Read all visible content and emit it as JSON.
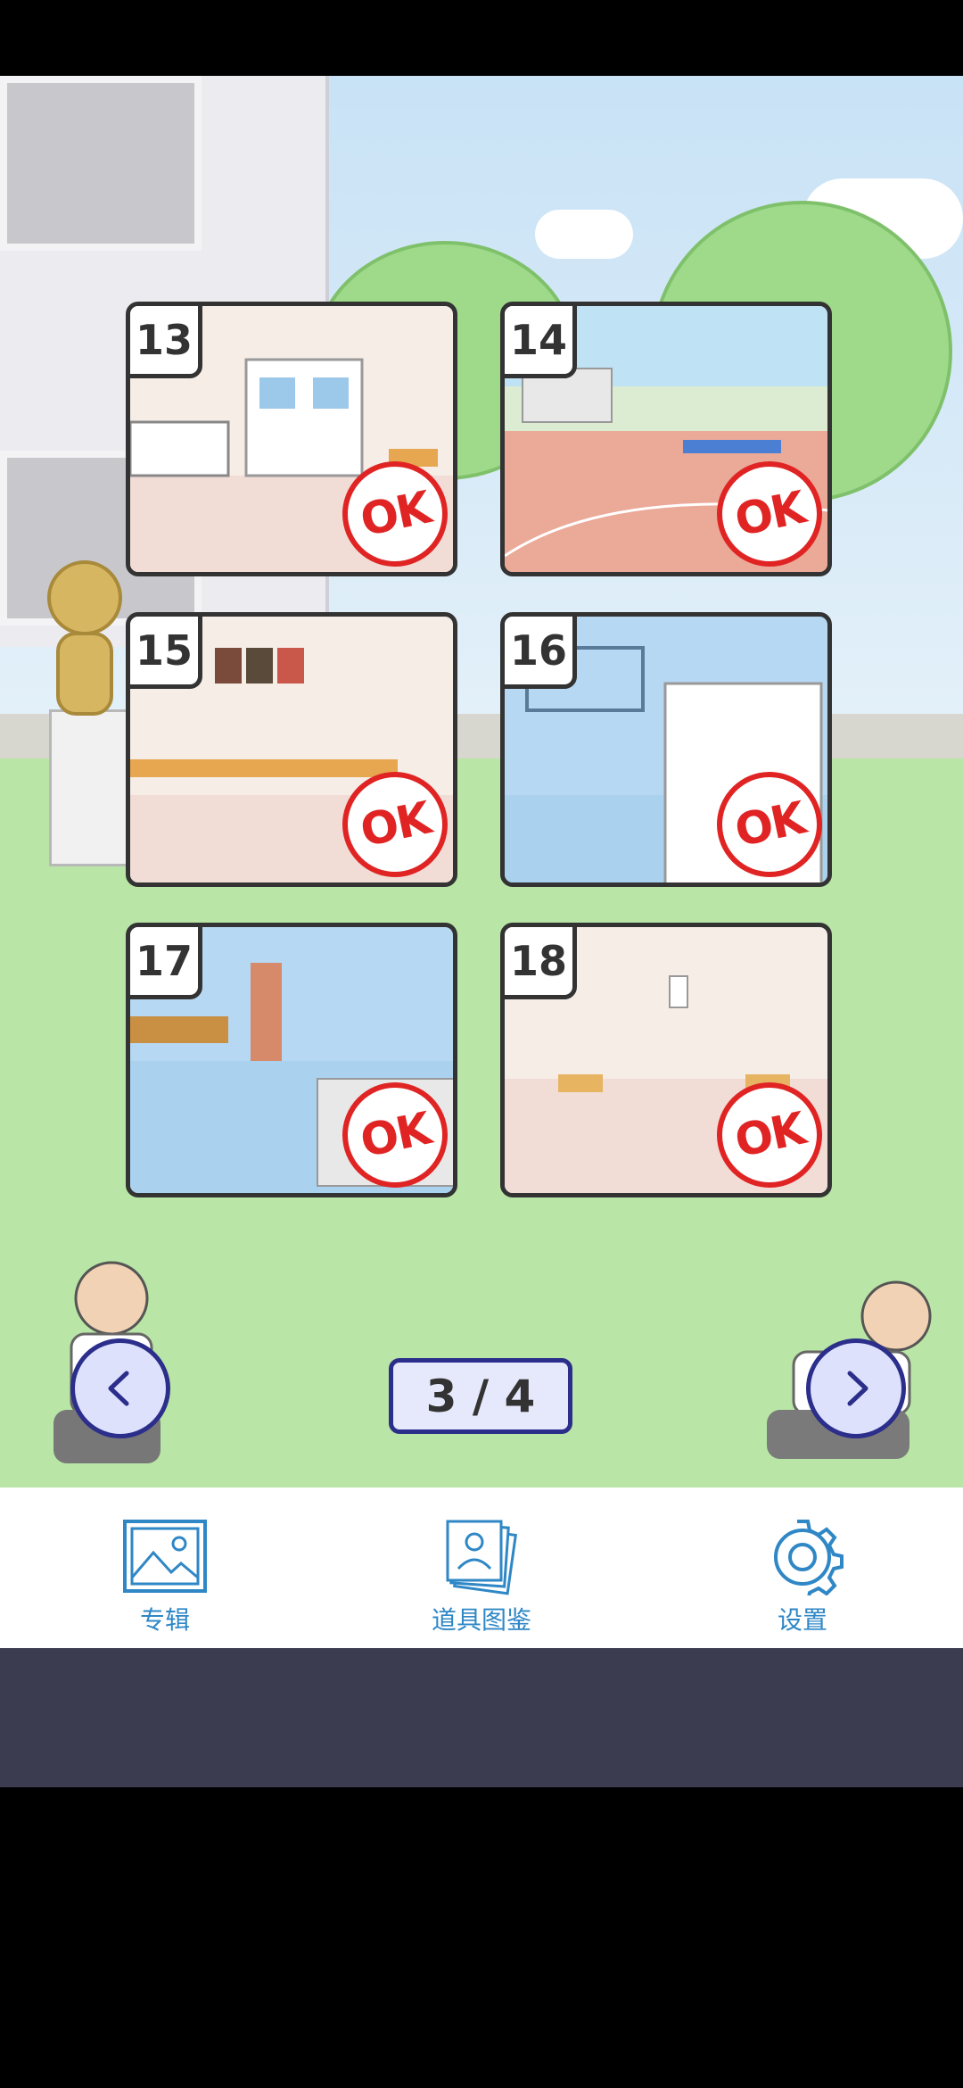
{
  "levels": [
    {
      "number": "13",
      "badge": "OK"
    },
    {
      "number": "14",
      "badge": "OK"
    },
    {
      "number": "15",
      "badge": "OK"
    },
    {
      "number": "16",
      "badge": "OK"
    },
    {
      "number": "17",
      "badge": "OK"
    },
    {
      "number": "18",
      "badge": "OK"
    }
  ],
  "pager": {
    "text": "3 / 4"
  },
  "tabs": [
    {
      "label": "专辑",
      "icon": "album-icon"
    },
    {
      "label": "道具图鉴",
      "icon": "item-catalog-icon"
    },
    {
      "label": "设置",
      "icon": "gear-icon"
    }
  ],
  "colors": {
    "ok_red": "#e02424",
    "accent_blue": "#2f87c6",
    "pager_border": "#2b2e8a"
  }
}
